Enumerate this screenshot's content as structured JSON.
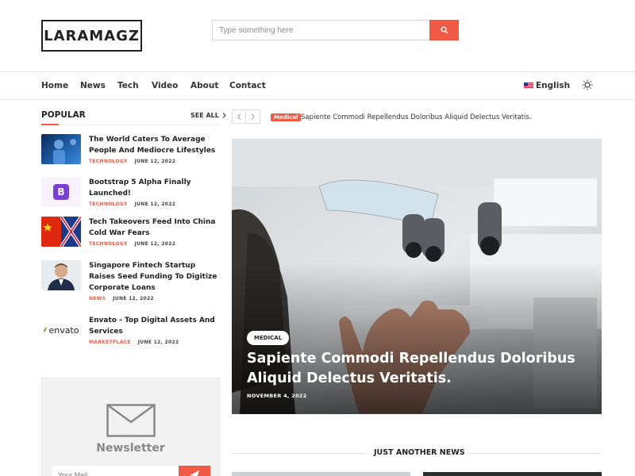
{
  "header": {
    "logo": "LARAMAGZ",
    "search": {
      "placeholder": "Type something here"
    }
  },
  "nav": {
    "items": [
      "Home",
      "News",
      "Tech",
      "Video",
      "About",
      "Contact"
    ],
    "language": "English"
  },
  "popular": {
    "title": "POPULAR",
    "see_all": "SEE ALL",
    "items": [
      {
        "title": "The World Caters To Average People And Mediocre Lifestyles",
        "category": "TECHNOLOGY",
        "date": "JUNE 12, 2022"
      },
      {
        "title": "Bootstrap 5 Alpha Finally Launched!",
        "category": "TECHNOLOGY",
        "date": "JUNE 12, 2022"
      },
      {
        "title": "Tech Takeovers Feed Into China Cold War Fears",
        "category": "TECHNOLOGY",
        "date": "JUNE 12, 2022"
      },
      {
        "title": "Singapore Fintech Startup Raises Seed Funding To Digitize Corporate Loans",
        "category": "NEWS",
        "date": "JUNE 12, 2022"
      },
      {
        "title": "Envato - Top Digital Assets And Services",
        "category": "MARKETPLACE",
        "date": "JUNE 12, 2022"
      }
    ],
    "thumb_labels": {
      "bootstrap": "B",
      "envato": "envato"
    }
  },
  "newsletter": {
    "title": "Newsletter",
    "placeholder": "Your Mail"
  },
  "ticker": {
    "badge": "Medical",
    "text": "Sapiente Commodi Repellendus Doloribus Aliquid Delectus Veritatis."
  },
  "hero": {
    "tag": "MEDICAL",
    "title": "Sapiente Commodi Repellendus Doloribus Aliquid Delectus Veritatis.",
    "date": "NOVEMBER 4, 2022"
  },
  "section": {
    "title": "JUST ANOTHER NEWS"
  },
  "colors": {
    "accent": "#f05a44"
  }
}
